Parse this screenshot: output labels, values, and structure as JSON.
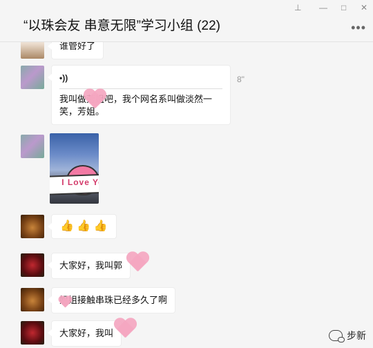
{
  "window": {
    "title": "“以珠会友 串意无限”学习小组 (22)",
    "controls": {
      "pin": "⊥",
      "minimize": "—",
      "maximize": "□",
      "close": "✕"
    },
    "more": "•••"
  },
  "messages": [
    {
      "type": "text",
      "text": "谁管好了"
    },
    {
      "type": "voice",
      "icon": "•))",
      "duration": "8\"",
      "transcript": "我叫做芳姐吧，我个网名系叫做淡然一笑，芳姐。"
    },
    {
      "type": "image",
      "sticker_text": "I Love You"
    },
    {
      "type": "emoji",
      "text": "👍 👍 👍"
    },
    {
      "type": "text",
      "text": "大家好，我叫郭"
    },
    {
      "type": "text",
      "text": "姐姐接触串珠已经多久了啊"
    },
    {
      "type": "text",
      "text": "大家好，我叫"
    }
  ],
  "watermark": {
    "text": "步新"
  }
}
